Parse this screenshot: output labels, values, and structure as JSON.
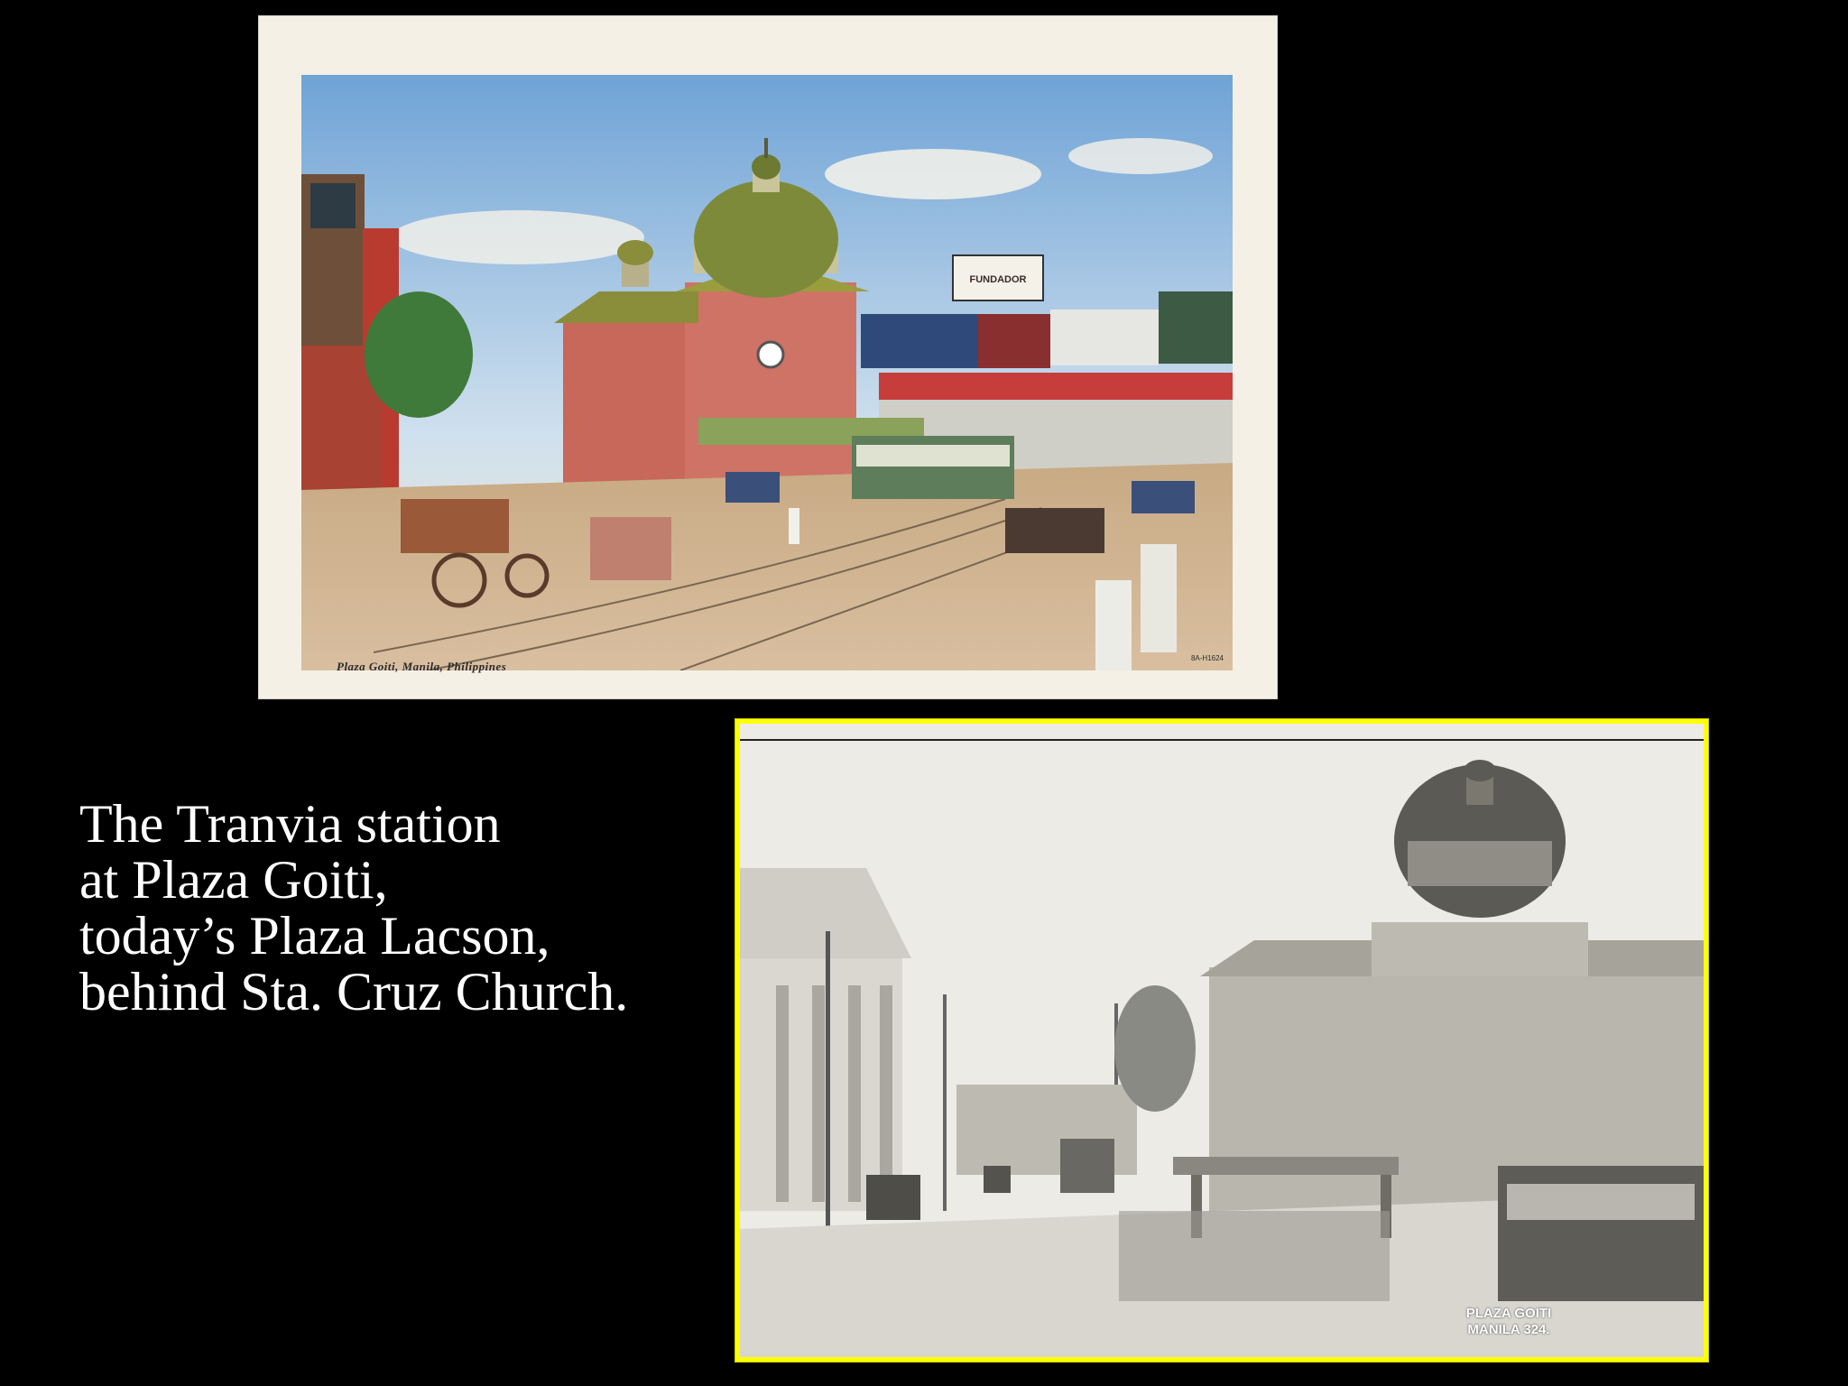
{
  "postcard": {
    "caption": "Plaza Goiti, Manila, Philippines",
    "code": "8A-H1624",
    "sign_text": "FUNDADOR"
  },
  "slide_text": {
    "line1": "The Tranvia station",
    "line2": "at Plaza Goiti,",
    "line3": "today’s Plaza Lacson,",
    "line4": "behind Sta. Cruz Church."
  },
  "photo": {
    "stamp_line1": "PLAZA GOITI",
    "stamp_line2": "MANILA 324."
  },
  "colors": {
    "background": "#000000",
    "photo_border": "#ffff00",
    "text": "#ffffff"
  }
}
